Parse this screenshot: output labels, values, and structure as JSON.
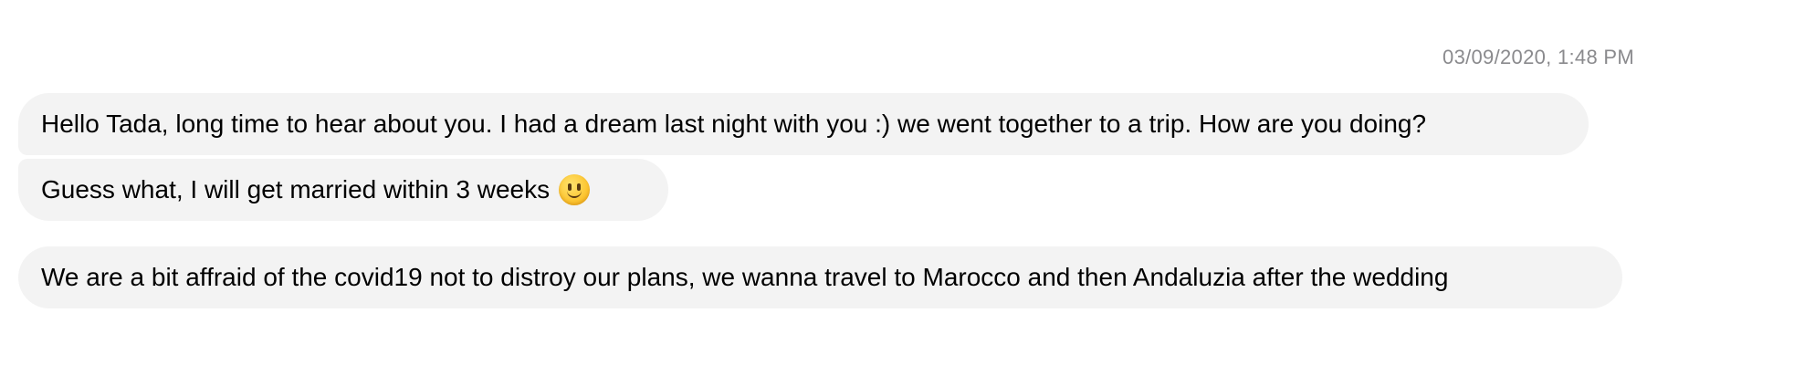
{
  "conversation": {
    "timestamp": "03/09/2020, 1:48 PM",
    "messages": [
      {
        "text": "Hello Tada, long time to hear about you. I had a dream last night with you :) we went together to a trip. How are you doing?"
      },
      {
        "text": "Guess what, I will get married within 3 weeks",
        "emoji": "slightly-smiling-face"
      },
      {
        "text": "We are a bit affraid of the covid19 not to distroy our plans, we wanna travel to Marocco and then Andaluzia after the wedding"
      }
    ]
  },
  "colors": {
    "bubble_background": "#f3f3f3",
    "timestamp_text": "#8a8a8d",
    "message_text": "#000000"
  }
}
